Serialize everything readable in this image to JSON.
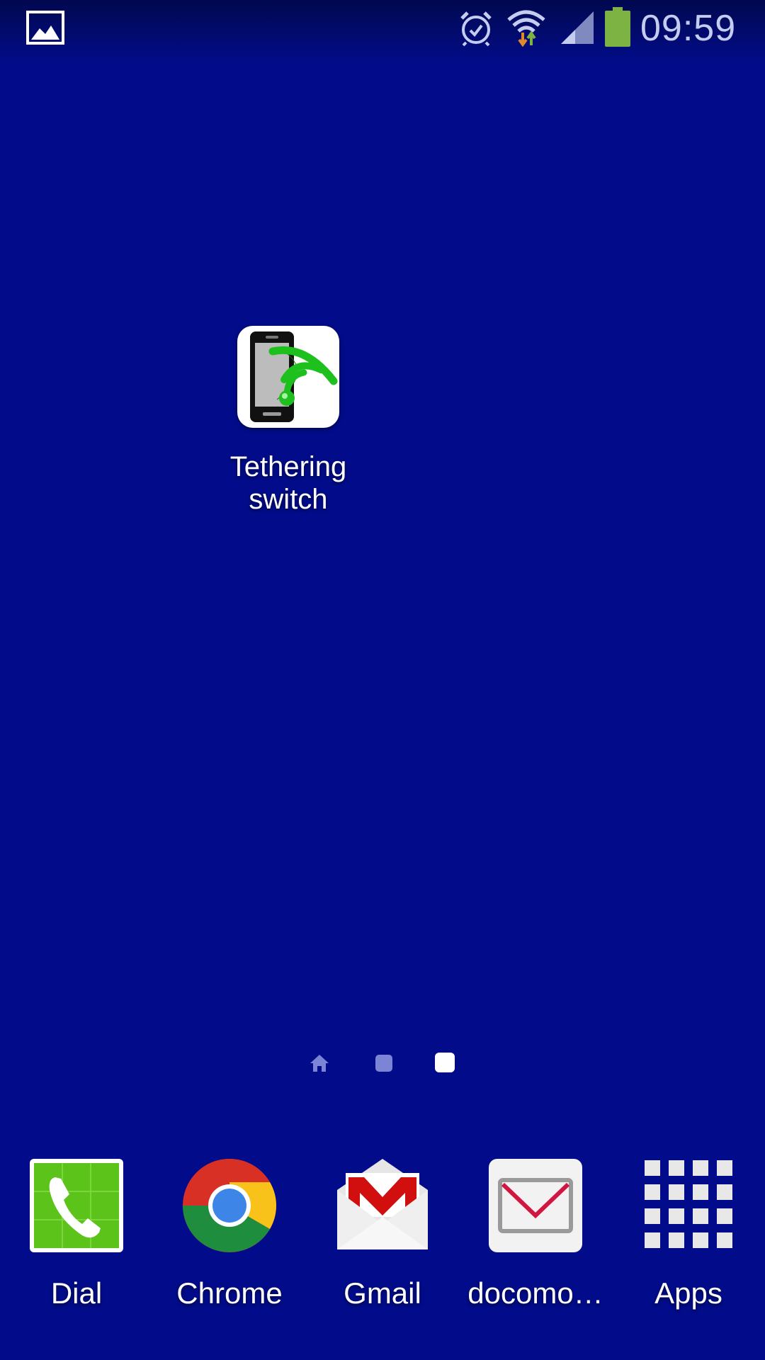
{
  "status_bar": {
    "time": "09:59",
    "icons": [
      "gallery-icon",
      "alarm-icon",
      "wifi-icon",
      "signal-icon",
      "battery-icon"
    ],
    "battery_color": "#7cb342"
  },
  "home": {
    "shortcuts": [
      {
        "label": "Tethering switch",
        "icon": "tethering-icon"
      }
    ]
  },
  "page_indicator": {
    "pages": [
      "home",
      "page",
      "page"
    ],
    "active_index": 2
  },
  "dock": {
    "items": [
      {
        "label": "Dial",
        "icon": "phone-icon"
      },
      {
        "label": "Chrome",
        "icon": "chrome-icon"
      },
      {
        "label": "Gmail",
        "icon": "gmail-icon"
      },
      {
        "label": "docomo…",
        "icon": "mail-icon"
      },
      {
        "label": "Apps",
        "icon": "apps-grid-icon"
      }
    ]
  },
  "colors": {
    "wallpaper": "#020c8a",
    "status_text": "#c4ccf0"
  }
}
